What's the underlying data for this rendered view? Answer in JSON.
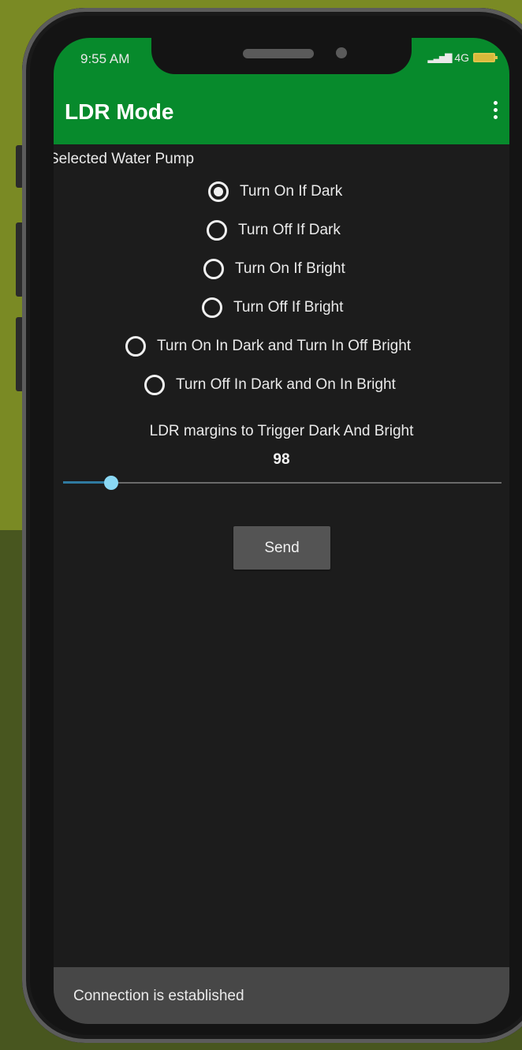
{
  "status_bar": {
    "time": "9:55 AM",
    "network": "4G",
    "battery_color": "#d8b93a"
  },
  "app_bar": {
    "title": "LDR Mode",
    "color": "#078a2c",
    "menu_icon": "more-vert-icon"
  },
  "selected_label": "Selected  Water Pump",
  "modes": {
    "selected_index": 0,
    "options": [
      "Turn On If Dark",
      "Turn Off If Dark",
      "Turn On If Bright",
      "Turn Off If Bright",
      "Turn On In Dark and Turn In Off Bright",
      "Turn Off In Dark and On In Bright"
    ]
  },
  "ldr": {
    "label": "LDR margins to Trigger Dark And Bright",
    "value": "98",
    "slider_fraction": 0.11
  },
  "send_button": {
    "label": "Send"
  },
  "snackbar": {
    "message": "Connection is established"
  }
}
